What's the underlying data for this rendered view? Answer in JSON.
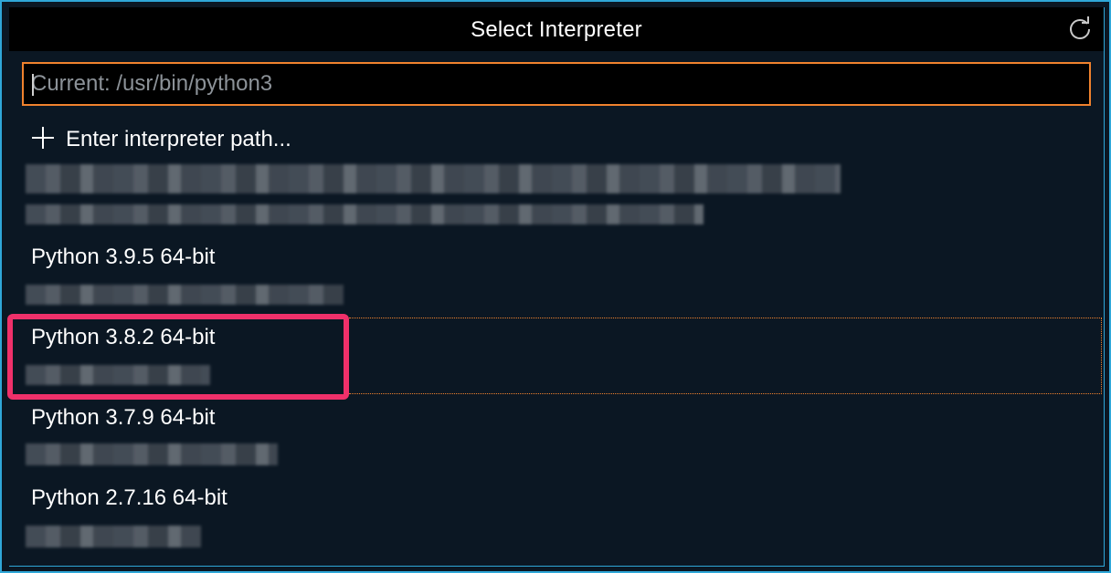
{
  "window": {
    "title": "Select Interpreter"
  },
  "icons": {
    "refresh": "refresh-icon",
    "add": "plus-icon"
  },
  "colors": {
    "frame_border": "#2fa7d8",
    "input_focus_border": "#f0822e",
    "annotation_highlight": "#f0306a",
    "background": "#0b1723"
  },
  "search": {
    "placeholder": "Current: /usr/bin/python3",
    "value": ""
  },
  "list": {
    "enter_path_label": "Enter interpreter path...",
    "items": [
      {
        "label": "",
        "sub": ""
      },
      {
        "label": "",
        "sub": ""
      },
      {
        "label": "Python 3.9.5 64-bit",
        "sub": ""
      },
      {
        "label": "Python 3.8.2 64-bit",
        "sub": "",
        "selected": true
      },
      {
        "label": "Python 3.7.9 64-bit",
        "sub": ""
      },
      {
        "label": "Python 2.7.16 64-bit",
        "sub": ""
      }
    ]
  }
}
